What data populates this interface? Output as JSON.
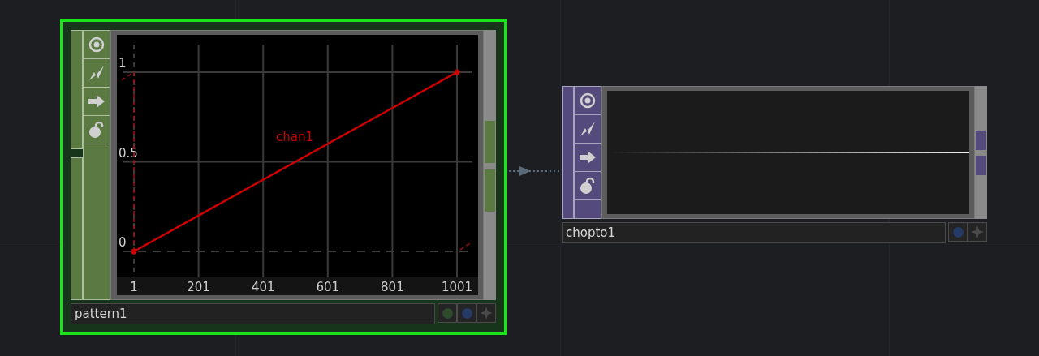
{
  "nodes": [
    {
      "name": "pattern1",
      "selected": true,
      "color": "#5a7a42",
      "kind": "chart",
      "viewer": {
        "chart_data": {
          "type": "line",
          "grid": true,
          "x": [
            1,
            1001
          ],
          "xlim": [
            1,
            1001
          ],
          "ylim": [
            0,
            1
          ],
          "xticks": [
            1,
            201,
            401,
            601,
            801,
            1001
          ],
          "yticks": [
            0,
            0.5,
            1
          ],
          "series": [
            {
              "name": "chan1",
              "color": "#cc0000",
              "marker": true,
              "values": [
                0,
                1
              ]
            }
          ]
        }
      },
      "footer_buttons": [
        {
          "kind": "dot",
          "color": "#2f4a2c"
        },
        {
          "kind": "dot",
          "color": "#253a66"
        },
        {
          "kind": "star"
        }
      ]
    },
    {
      "name": "chopto1",
      "selected": false,
      "color": "#544a7c",
      "kind": "waveform",
      "footer_buttons": [
        {
          "kind": "dot",
          "color": "#253a66"
        },
        {
          "kind": "star"
        }
      ]
    }
  ]
}
